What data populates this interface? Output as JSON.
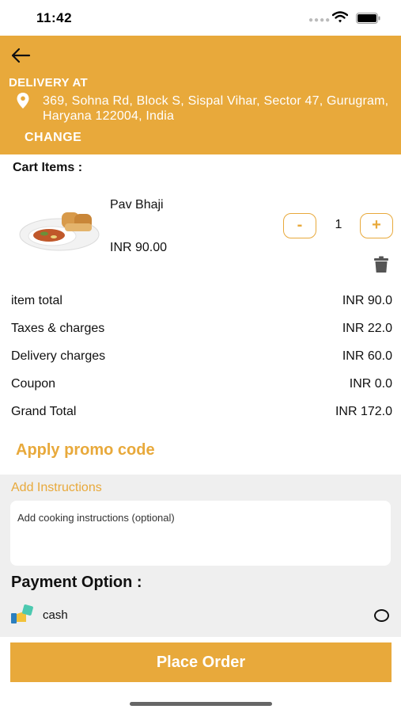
{
  "status_bar": {
    "time": "11:42"
  },
  "header": {
    "delivery_label": "DELIVERY AT",
    "address": "369, Sohna Rd, Block S, Sispal Vihar, Sector 47, Gurugram, Haryana 122004, India",
    "change_label": "CHANGE"
  },
  "cart": {
    "title": "Cart Items :",
    "items": [
      {
        "name": "Pav Bhaji",
        "price": "INR 90.00",
        "quantity": "1",
        "minus_label": "-",
        "plus_label": "+"
      }
    ]
  },
  "summary": [
    {
      "label": "item total",
      "value": "INR 90.0"
    },
    {
      "label": "Taxes & charges",
      "value": "INR 22.0"
    },
    {
      "label": "Delivery charges",
      "value": "INR 60.0"
    },
    {
      "label": "Coupon",
      "value": "INR 0.0"
    },
    {
      "label": "Grand Total",
      "value": "INR 172.0"
    }
  ],
  "promo_label": "Apply promo code",
  "instructions": {
    "title": "Add Instructions",
    "placeholder": "Add cooking instructions (optional)"
  },
  "payment": {
    "title": "Payment Option :",
    "options": [
      {
        "label": "cash"
      }
    ]
  },
  "place_order_label": "Place Order",
  "colors": {
    "accent": "#E8A93B",
    "section_bg": "#EFEFEF"
  }
}
